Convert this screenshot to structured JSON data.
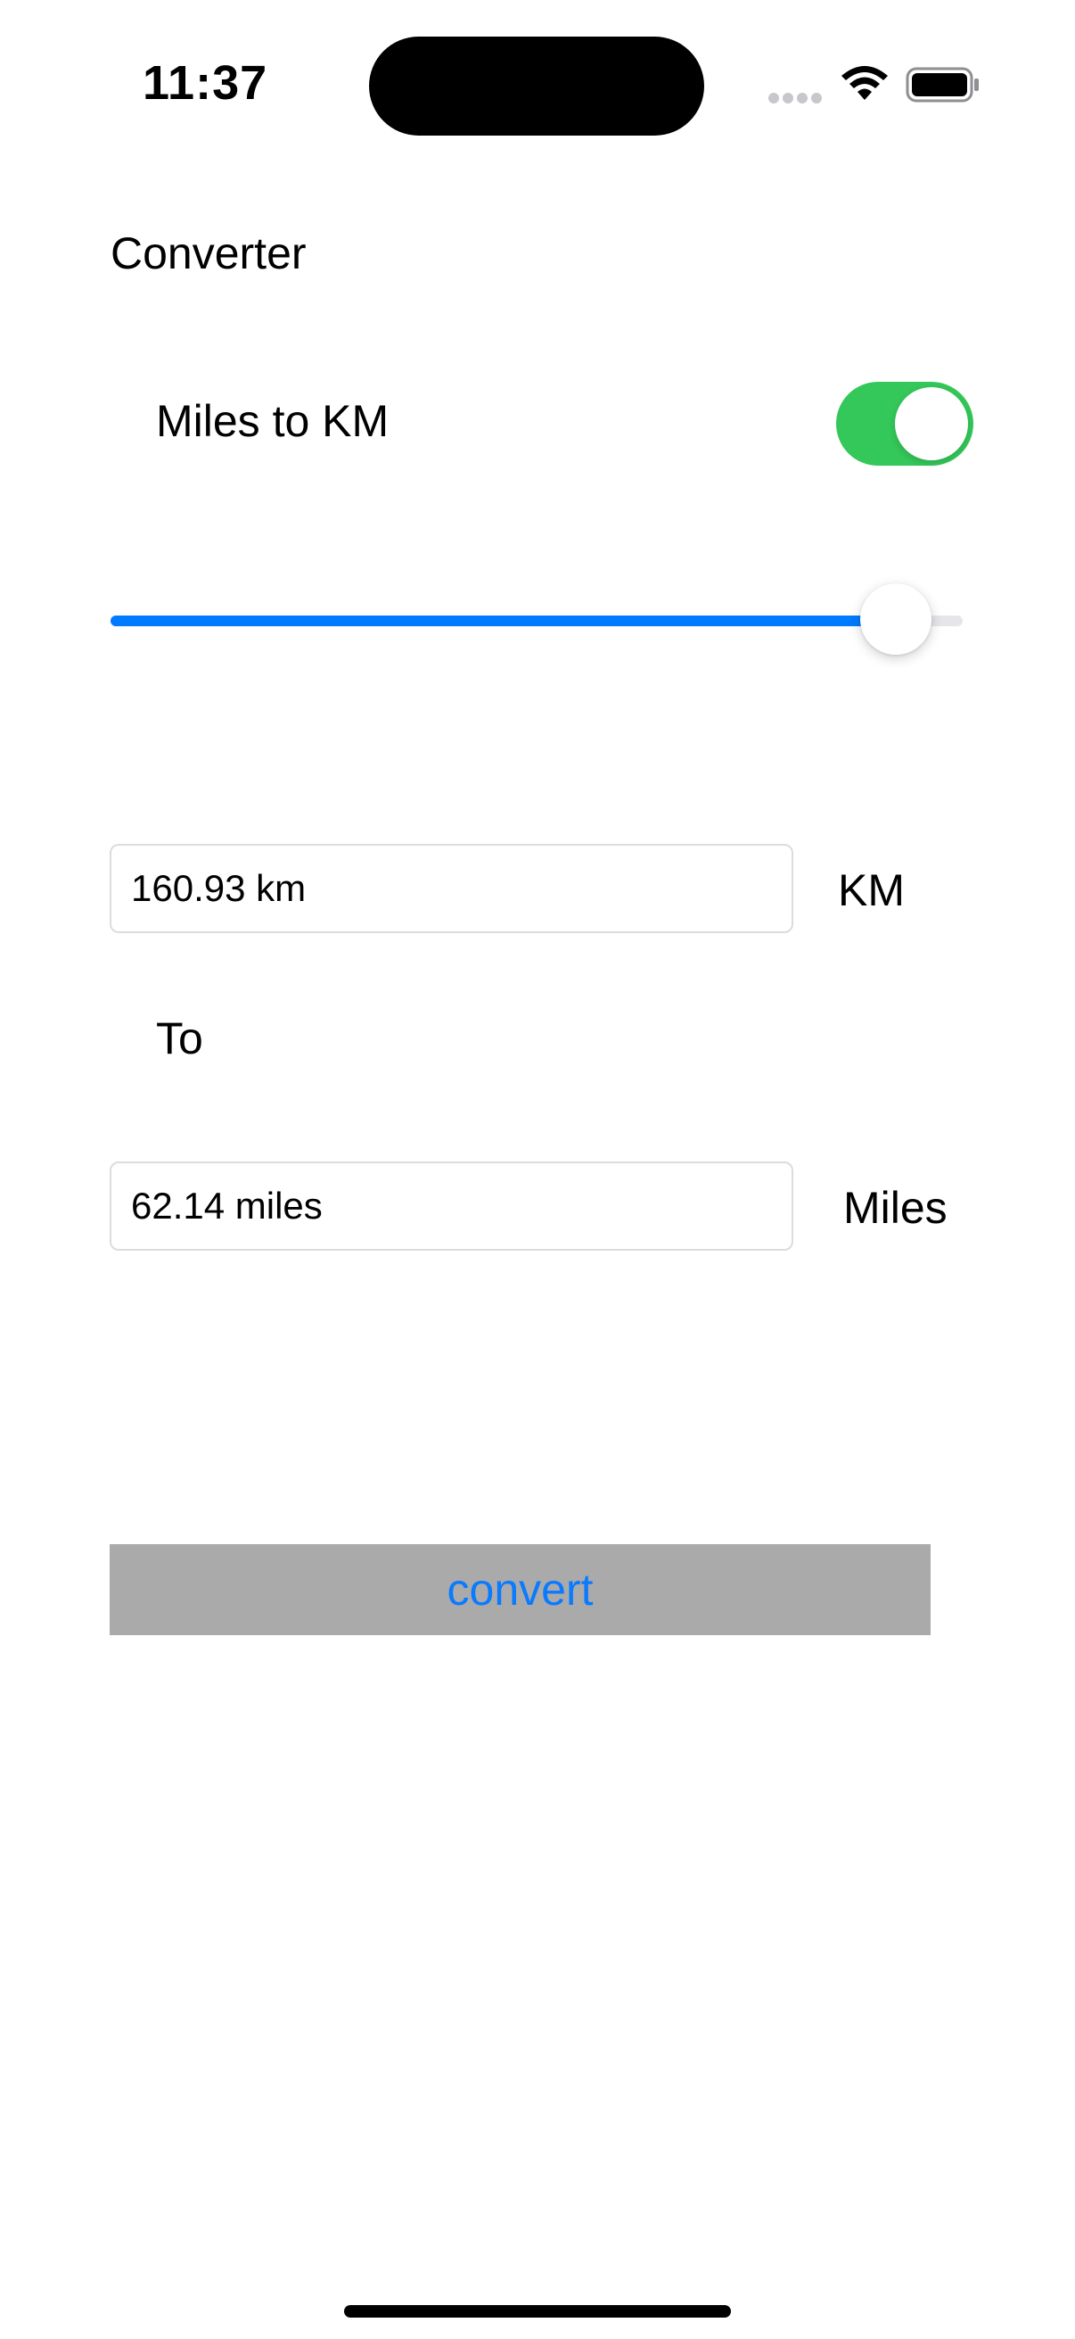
{
  "status_bar": {
    "time": "11:37",
    "icons": [
      "cellular-signal-icon",
      "wifi-icon",
      "battery-icon"
    ]
  },
  "page": {
    "title": "Converter"
  },
  "toggle": {
    "label": "Miles to KM",
    "on": true
  },
  "slider": {
    "value": 0.96
  },
  "km_field": {
    "value": "160.93 km",
    "unit_label": "KM"
  },
  "to_label": "To",
  "miles_field": {
    "value": "62.14 miles",
    "unit_label": "Miles"
  },
  "convert_button": {
    "label": "convert"
  },
  "colors": {
    "accent": "#007aff",
    "toggle_on": "#34c759",
    "button_background": "#aaaaaa",
    "button_text": "#0a7aff"
  }
}
